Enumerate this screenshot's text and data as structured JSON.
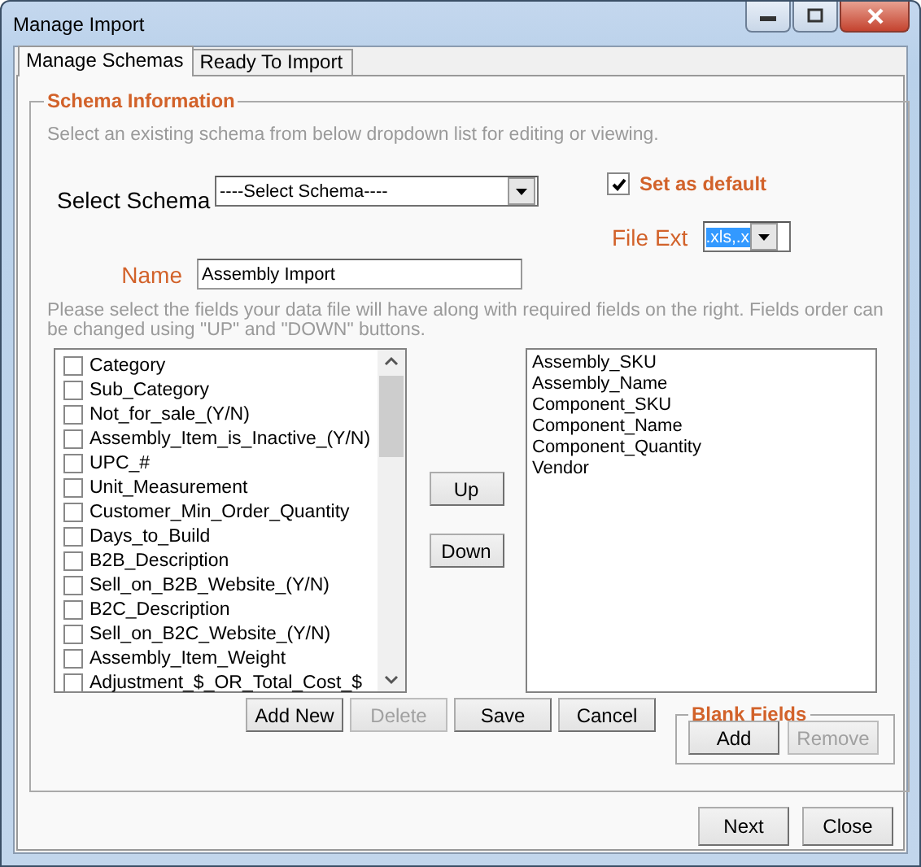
{
  "window": {
    "title": "Manage Import"
  },
  "tabs": [
    {
      "label": "Manage Schemas",
      "selected": true
    },
    {
      "label": "Ready To Import",
      "selected": false
    }
  ],
  "schema_information": {
    "title": "Schema Information",
    "hint": "Select an existing schema from below dropdown list for editing or viewing.",
    "select_schema": {
      "label": "Select Schema",
      "value": "----Select Schema----"
    },
    "set_as_default": {
      "label": "Set as default",
      "checked": true
    },
    "file_ext": {
      "label": "File Ext",
      "value": ".xls,.x"
    },
    "name": {
      "label": "Name",
      "value": "Assembly Import"
    },
    "fields_hint": "Please select the fields your data file will have along with required fields on the right. Fields order can be changed using \"UP\" and \"DOWN\" buttons.",
    "available_fields": [
      {
        "label": "Category",
        "checked": false
      },
      {
        "label": "Sub_Category",
        "checked": false
      },
      {
        "label": "Not_for_sale_(Y/N)",
        "checked": false
      },
      {
        "label": "Assembly_Item_is_Inactive_(Y/N)",
        "checked": false
      },
      {
        "label": "UPC_#",
        "checked": false
      },
      {
        "label": "Unit_Measurement",
        "checked": false
      },
      {
        "label": "Customer_Min_Order_Quantity",
        "checked": false
      },
      {
        "label": "Days_to_Build",
        "checked": false
      },
      {
        "label": "B2B_Description",
        "checked": false
      },
      {
        "label": "Sell_on_B2B_Website_(Y/N)",
        "checked": false
      },
      {
        "label": "B2C_Description",
        "checked": false
      },
      {
        "label": "Sell_on_B2C_Website_(Y/N)",
        "checked": false
      },
      {
        "label": "Assembly_Item_Weight",
        "checked": false
      },
      {
        "label": "Adjustment_$_OR_Total_Cost_$",
        "checked": false
      }
    ],
    "up_button": "Up",
    "down_button": "Down",
    "selected_fields": [
      "Assembly_SKU",
      "Assembly_Name",
      "Component_SKU",
      "Component_Name",
      "Component_Quantity",
      "Vendor"
    ],
    "buttons": [
      {
        "label": "Add New",
        "disabled": false
      },
      {
        "label": "Delete",
        "disabled": true
      },
      {
        "label": "Save",
        "disabled": false
      },
      {
        "label": "Cancel",
        "disabled": false
      }
    ],
    "blank_fields": {
      "title": "Blank Fields",
      "buttons": [
        {
          "label": "Add",
          "disabled": false
        },
        {
          "label": "Remove",
          "disabled": true
        }
      ]
    }
  },
  "footer_buttons": [
    {
      "label": "Next",
      "disabled": false
    },
    {
      "label": "Close",
      "disabled": false
    }
  ]
}
